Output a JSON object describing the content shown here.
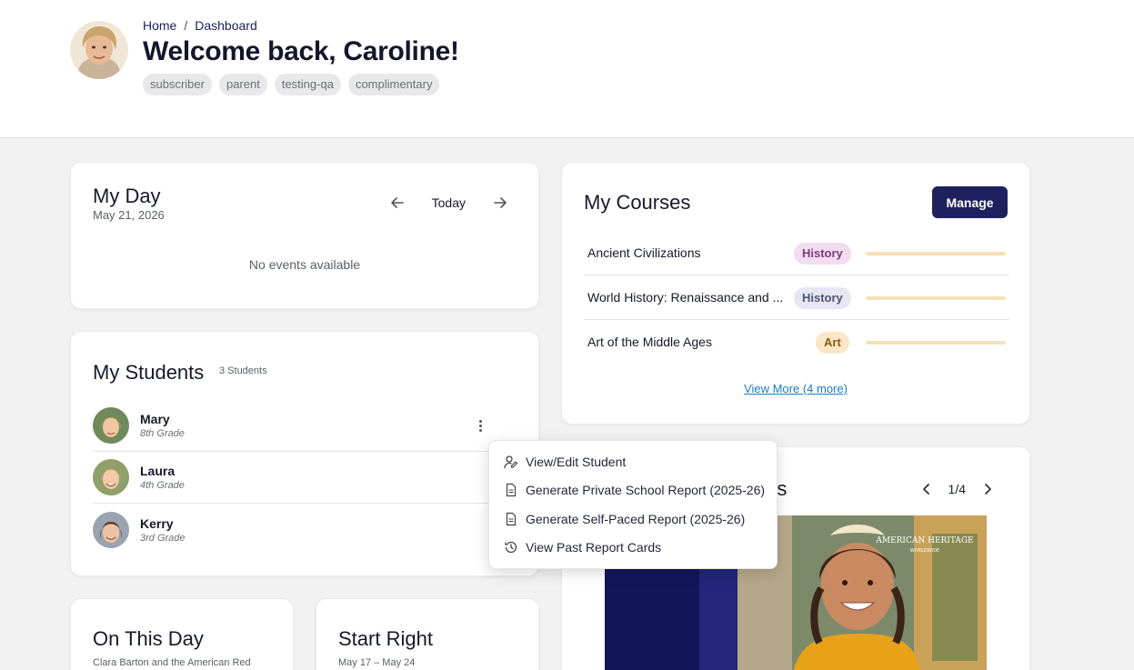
{
  "header": {
    "breadcrumb": [
      "Home",
      "/",
      "Dashboard"
    ],
    "welcome": "Welcome back, Caroline!",
    "tags": [
      "subscriber",
      "parent",
      "testing-qa",
      "complimentary"
    ]
  },
  "my_day": {
    "title": "My Day",
    "date": "May 21, 2026",
    "today_label": "Today",
    "empty_text": "No events available"
  },
  "students": {
    "title": "My Students",
    "count_label": "3 Students",
    "items": [
      {
        "name": "Mary",
        "grade": "8th Grade"
      },
      {
        "name": "Laura",
        "grade": "4th Grade"
      },
      {
        "name": "Kerry",
        "grade": "3rd Grade"
      }
    ]
  },
  "on_this_day": {
    "title": "On This Day",
    "subtitle": "Clara Barton and the American Red"
  },
  "start_right": {
    "title": "Start Right",
    "subtitle": "May 17 – May 24"
  },
  "courses": {
    "title": "My Courses",
    "manage_label": "Manage",
    "items": [
      {
        "name": "Ancient Civilizations",
        "subject": "History",
        "badge_bg": "#f1dcf0",
        "badge_fg": "#7b3c77"
      },
      {
        "name": "World History: Renaissance and ...",
        "subject": "History",
        "badge_bg": "#e6e7f3",
        "badge_fg": "#4e5276"
      },
      {
        "name": "Art of the Middle Ages",
        "subject": "Art",
        "badge_bg": "#fbe6c7",
        "badge_fg": "#8a5a12"
      }
    ],
    "view_more": "View More (4 more)"
  },
  "announcements": {
    "title_fragment": "nts",
    "pager": "1/4",
    "banner_brand": "AMERICAN HERITAGE",
    "banner_sub": "WORLDWIDE"
  },
  "context_menu": {
    "items": [
      {
        "label": "View/Edit Student",
        "icon": "user-edit-icon"
      },
      {
        "label": "Generate Private School Report (2025-26)",
        "icon": "document-icon"
      },
      {
        "label": "Generate Self-Paced Report (2025-26)",
        "icon": "document-icon"
      },
      {
        "label": "View Past Report Cards",
        "icon": "history-icon"
      }
    ]
  },
  "colors": {
    "primary": "#1e215e",
    "link": "#1b7bc4",
    "progress_track": "#f8dfb5"
  }
}
